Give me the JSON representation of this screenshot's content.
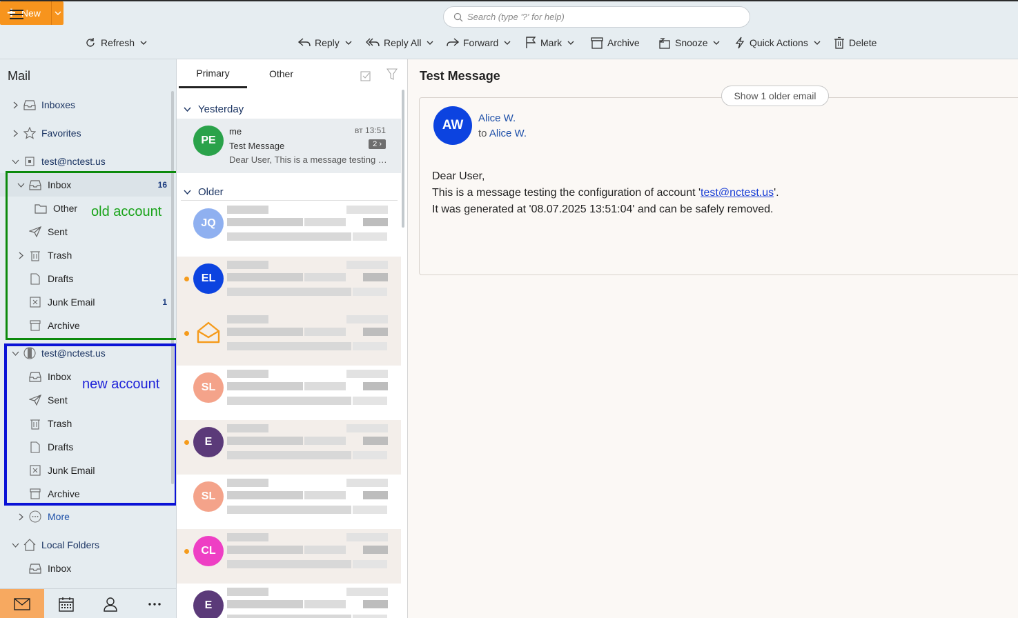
{
  "search": {
    "placeholder": "Search (type '?' for help)"
  },
  "toolbar": {
    "new_label": "New",
    "refresh_label": "Refresh",
    "reply_label": "Reply",
    "reply_all_label": "Reply All",
    "forward_label": "Forward",
    "mark_label": "Mark",
    "archive_label": "Archive",
    "snooze_label": "Snooze",
    "quick_actions_label": "Quick Actions",
    "delete_label": "Delete"
  },
  "sidebar": {
    "title": "Mail",
    "top": [
      {
        "label": "Inboxes"
      },
      {
        "label": "Favorites"
      }
    ],
    "old_account": {
      "label": "test@nctest.us",
      "folders": [
        {
          "label": "Inbox",
          "count": "16"
        },
        {
          "label": "Other"
        },
        {
          "label": "Sent"
        },
        {
          "label": "Trash"
        },
        {
          "label": "Drafts"
        },
        {
          "label": "Junk Email",
          "count": "1"
        },
        {
          "label": "Archive"
        }
      ]
    },
    "new_account": {
      "label": "test@nctest.us",
      "folders": [
        {
          "label": "Inbox"
        },
        {
          "label": "Sent"
        },
        {
          "label": "Trash"
        },
        {
          "label": "Drafts"
        },
        {
          "label": "Junk Email"
        },
        {
          "label": "Archive"
        }
      ]
    },
    "more_label": "More",
    "local_folders": {
      "label": "Local Folders",
      "folders": [
        {
          "label": "Inbox"
        }
      ]
    }
  },
  "annotations": {
    "old_account": "old account",
    "new_account": "new account"
  },
  "list": {
    "tabs": [
      {
        "label": "Primary"
      },
      {
        "label": "Other"
      }
    ],
    "groups": {
      "yesterday": "Yesterday",
      "older": "Older"
    },
    "selected_message": {
      "initials": "PE",
      "sender": "me",
      "time": "вт 13:51",
      "subject": "Test Message",
      "thread_count": "2 ›",
      "preview": "Dear User, This is a message testing t..."
    },
    "older_messages": [
      {
        "initials": "JQ",
        "color": "#8fb0f0",
        "unread": false
      },
      {
        "initials": "EL",
        "color": "#0c43e0",
        "unread": true
      },
      {
        "initials": "",
        "color": "#f59b1c",
        "unread": true
      },
      {
        "initials": "SL",
        "color": "#f4a38a",
        "unread": false
      },
      {
        "initials": "E",
        "color": "#5b3a79",
        "unread": true
      },
      {
        "initials": "SL",
        "color": "#f4a38a",
        "unread": false
      },
      {
        "initials": "CL",
        "color": "#ee3fc4",
        "unread": true
      },
      {
        "initials": "E",
        "color": "#5b3a79",
        "unread": false
      }
    ]
  },
  "reader": {
    "title": "Test Message",
    "older_button": "Show 1 older email",
    "avatar_initials": "AW",
    "from_name": "Alice W.",
    "to_prefix": "to",
    "to_name": "Alice W.",
    "greeting": "Dear User,",
    "line1_before": "This is a message testing the configuration of account '",
    "line1_link": "test@nctest.us",
    "line1_after": "'.",
    "line2": "It was generated at '08.07.2025 13:51:04' and can be safely removed."
  },
  "colors": {
    "accent": "#f7941d",
    "old_account_box": "#0c8a0c",
    "new_account_box": "#0a12d6",
    "avatar_aw": "#0c43e0",
    "avatar_pe": "#2aa24a"
  }
}
